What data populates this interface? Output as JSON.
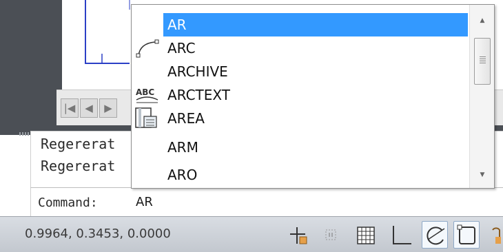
{
  "popup": {
    "items": [
      {
        "label": "AR",
        "icon": "none"
      },
      {
        "label": "ARC",
        "icon": "arc-icon"
      },
      {
        "label": "ARCHIVE",
        "icon": "none"
      },
      {
        "label": "ARCTEXT",
        "icon": "arctext-icon"
      },
      {
        "label": "AREA",
        "icon": "area-icon"
      },
      {
        "label": "ARM",
        "icon": "none"
      },
      {
        "label": "ARO",
        "icon": "none"
      }
    ],
    "selected_index": 0,
    "selected_color": "#3399ff"
  },
  "history": {
    "lines": [
      "Regererat",
      "Regererat"
    ]
  },
  "command": {
    "prompt": "Command:",
    "value": "AR"
  },
  "status": {
    "coordinates": "0.9964, 0.3453, 0.0000",
    "buttons": [
      {
        "name": "infer-constraints",
        "icon": "infer-icon",
        "on": false
      },
      {
        "name": "snap-mode",
        "icon": "snap-icon",
        "on": false
      },
      {
        "name": "grid-display",
        "icon": "grid-icon",
        "on": false
      },
      {
        "name": "ortho-mode",
        "icon": "ortho-icon",
        "on": false
      },
      {
        "name": "polar-tracking",
        "icon": "polar-icon",
        "on": true
      },
      {
        "name": "object-snap",
        "icon": "osnap-icon",
        "on": true
      }
    ]
  },
  "layout_nav": {
    "first": "first-layout-icon",
    "prev": "prev-layout-icon",
    "next": "next-layout-icon"
  }
}
